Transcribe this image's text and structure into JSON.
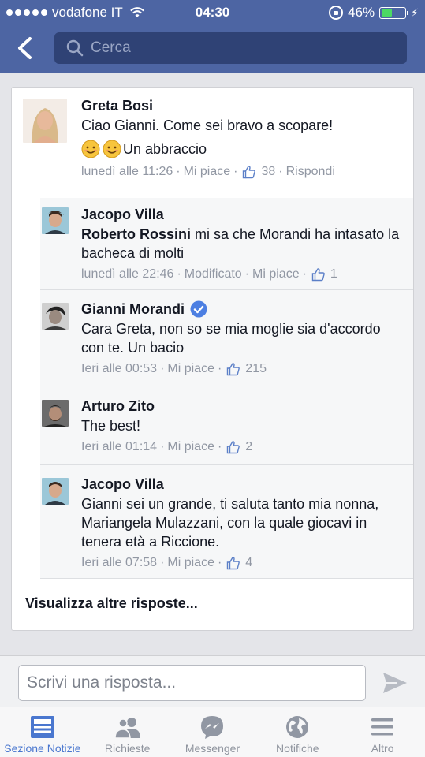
{
  "status_bar": {
    "carrier": "vodafone IT",
    "time": "04:30",
    "battery": "46%",
    "battery_level": 0.46
  },
  "search": {
    "placeholder": "Cerca"
  },
  "comments": [
    {
      "name": "Greta Bosi",
      "text": "Ciao Gianni. Come sei bravo a scopare!",
      "text2": "Un abbraccio",
      "time": "lunedì alle 11:26",
      "like": "Mi piace",
      "likes": "38",
      "reply": "Rispondi"
    },
    {
      "name": "Jacopo Villa",
      "mention": "Roberto Rossini",
      "text": " mi sa che Morandi ha intasato la bacheca di molti",
      "time": "lunedì alle 22:46",
      "edited": "Modificato",
      "like": "Mi piace",
      "likes": "1"
    },
    {
      "name": "Gianni Morandi",
      "text": "Cara Greta, non so se mia moglie sia d'accordo con te. Un bacio",
      "time": "Ieri alle 00:53",
      "like": "Mi piace",
      "likes": "215"
    },
    {
      "name": "Arturo Zito",
      "text": "The best!",
      "time": "Ieri alle 01:14",
      "like": "Mi piace",
      "likes": "2"
    },
    {
      "name": "Jacopo Villa",
      "text": "Gianni sei un grande, ti saluta tanto mia nonna, Mariangela Mulazzani, con la quale giocavi in tenera età a Riccione.",
      "time": "Ieri alle 07:58",
      "like": "Mi piace",
      "likes": "4"
    }
  ],
  "more_replies": "Visualizza altre risposte...",
  "composer": {
    "placeholder": "Scrivi una risposta..."
  },
  "tabs": [
    {
      "label": "Sezione Notizie",
      "icon": "news-feed-icon",
      "active": true
    },
    {
      "label": "Richieste",
      "icon": "friend-requests-icon"
    },
    {
      "label": "Messenger",
      "icon": "messenger-icon"
    },
    {
      "label": "Notifiche",
      "icon": "globe-icon"
    },
    {
      "label": "Altro",
      "icon": "menu-icon"
    }
  ],
  "colors": {
    "header": "#4d65a3",
    "accent": "#4a77cf",
    "meta": "#9197a3"
  }
}
